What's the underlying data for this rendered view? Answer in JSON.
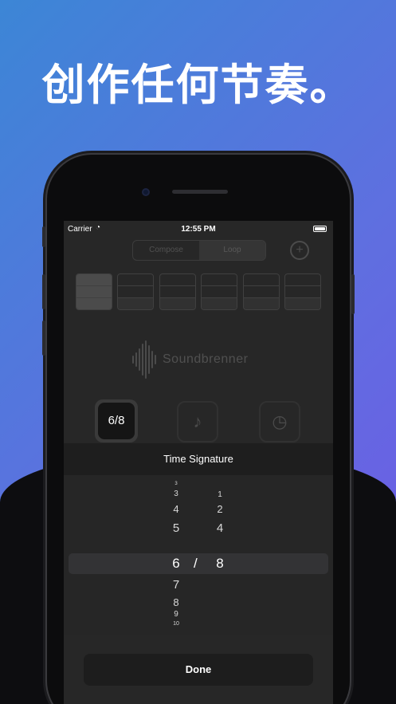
{
  "headline": "创作任何节奏。",
  "status_bar": {
    "carrier": "Carrier",
    "time": "12:55 PM"
  },
  "app": {
    "tabs": [
      {
        "label": "Compose"
      },
      {
        "label": "Loop"
      }
    ],
    "add_icon": "plus-circle-icon",
    "logo_text": "Soundbrenner",
    "time_signature_value": "6/8",
    "note_icon": "music-note-icon",
    "timer_icon": "clock-icon"
  },
  "sheet": {
    "title": "Time Signature",
    "beats_column": [
      "3",
      "3",
      "4",
      "5",
      "6",
      "7",
      "8",
      "9",
      "10"
    ],
    "note_column": [
      "1",
      "2",
      "4",
      "8"
    ],
    "separator": "/",
    "done_label": "Done"
  },
  "colors": {
    "gradient_start": "#3c86d6",
    "gradient_end": "#7058e6",
    "screen_bg": "#272727"
  }
}
